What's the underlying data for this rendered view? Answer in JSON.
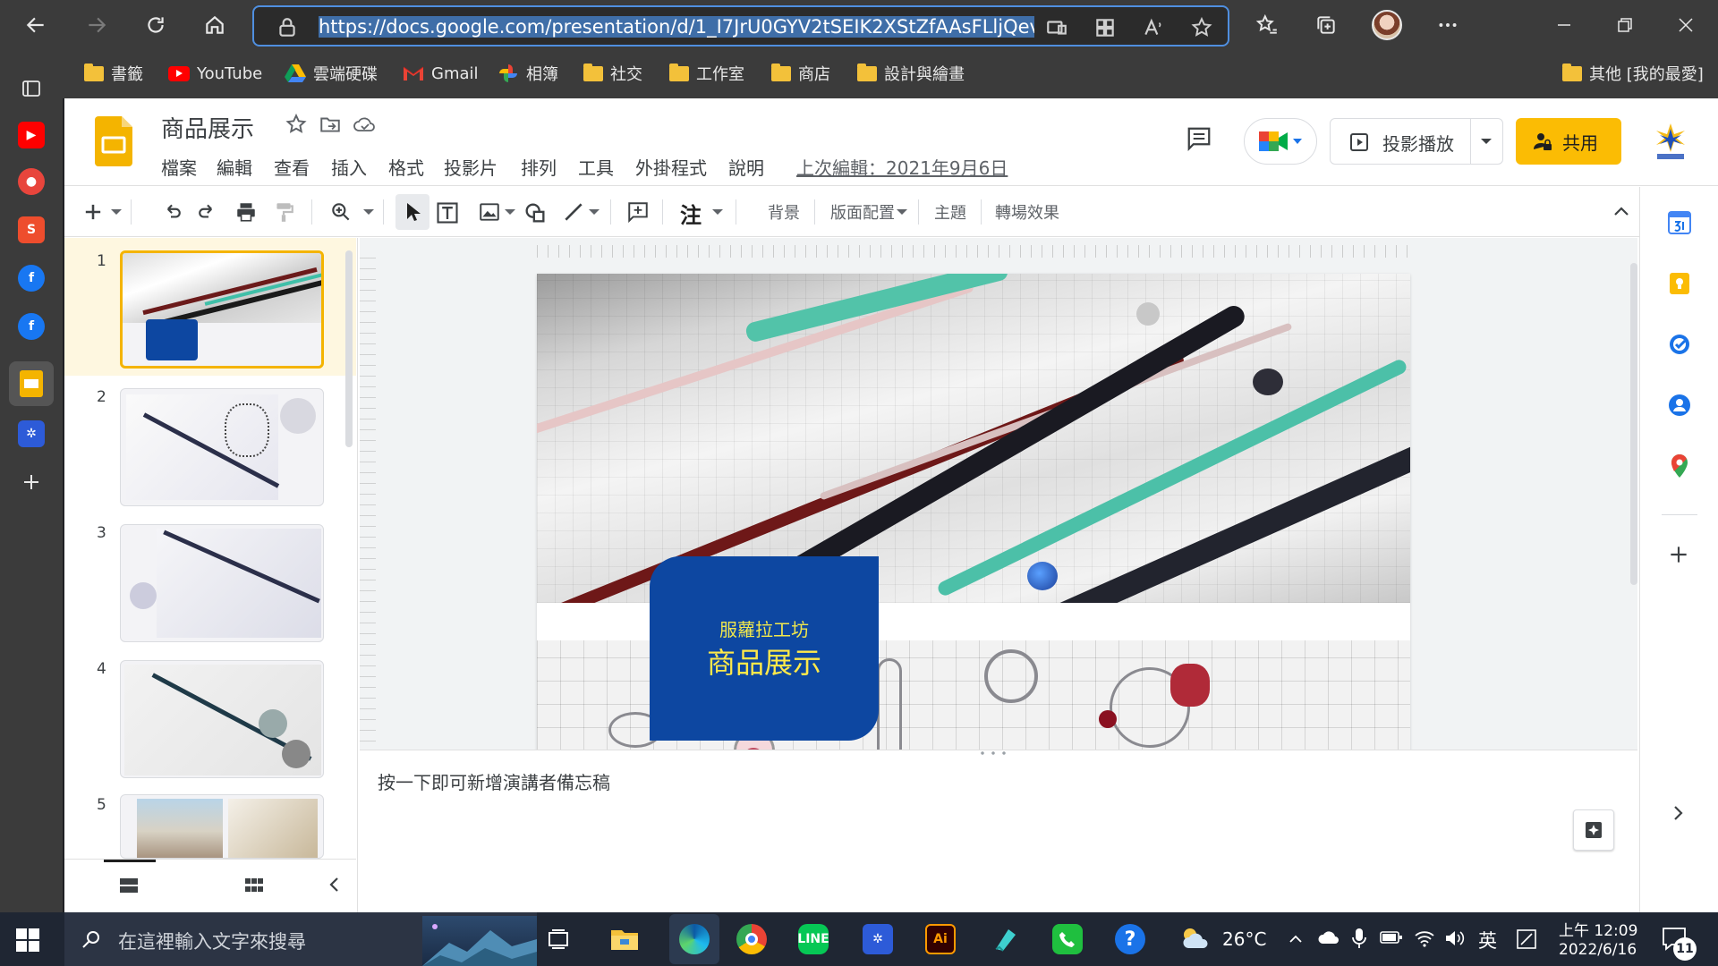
{
  "browser": {
    "url": "https://docs.google.com/presentation/d/1_I7JrU0GYV2tSEIK2XStZfAAsFLljQev04iLuH_",
    "bookmarks": [
      {
        "label": "書籤",
        "icon": "folder-icon"
      },
      {
        "label": "YouTube",
        "icon": "youtube-icon"
      },
      {
        "label": "雲端硬碟",
        "icon": "google-drive-icon"
      },
      {
        "label": "Gmail",
        "icon": "gmail-icon"
      },
      {
        "label": "相簿",
        "icon": "google-photos-icon"
      },
      {
        "label": "社交",
        "icon": "folder-icon"
      },
      {
        "label": "工作室",
        "icon": "folder-icon"
      },
      {
        "label": "商店",
        "icon": "folder-icon"
      },
      {
        "label": "設計與繪畫",
        "icon": "folder-icon"
      }
    ],
    "other_favorites": "其他 [我的最愛]"
  },
  "slides": {
    "title": "商品展示",
    "menu": [
      "檔案",
      "編輯",
      "查看",
      "插入",
      "格式",
      "投影片",
      "排列",
      "工具",
      "外掛程式",
      "說明"
    ],
    "last_edit": "上次編輯：2021年9月6日",
    "present_label": "投影播放",
    "share_label": "共用",
    "toolbar": {
      "background": "背景",
      "layout": "版面配置",
      "theme": "主題",
      "transition": "轉場效果",
      "comment_glyph": "注"
    },
    "thumbnails": [
      "1",
      "2",
      "3",
      "4",
      "5"
    ],
    "slide": {
      "subtitle": "服蘿拉工坊",
      "title": "商品展示"
    },
    "notes_placeholder": "按一下即可新增演講者備忘稿"
  },
  "colors": {
    "title_box": "#0d47a1",
    "subtitle_text": "#f2e84c",
    "title_text": "#ffe94a",
    "share_button": "#fbbc04",
    "address_border": "#4f8fe0"
  },
  "taskbar": {
    "search_placeholder": "在這裡輸入文字來搜尋",
    "weather": "26°C",
    "ime": "英",
    "time": "上午 12:09",
    "date": "2022/6/16",
    "notifications": "11"
  }
}
